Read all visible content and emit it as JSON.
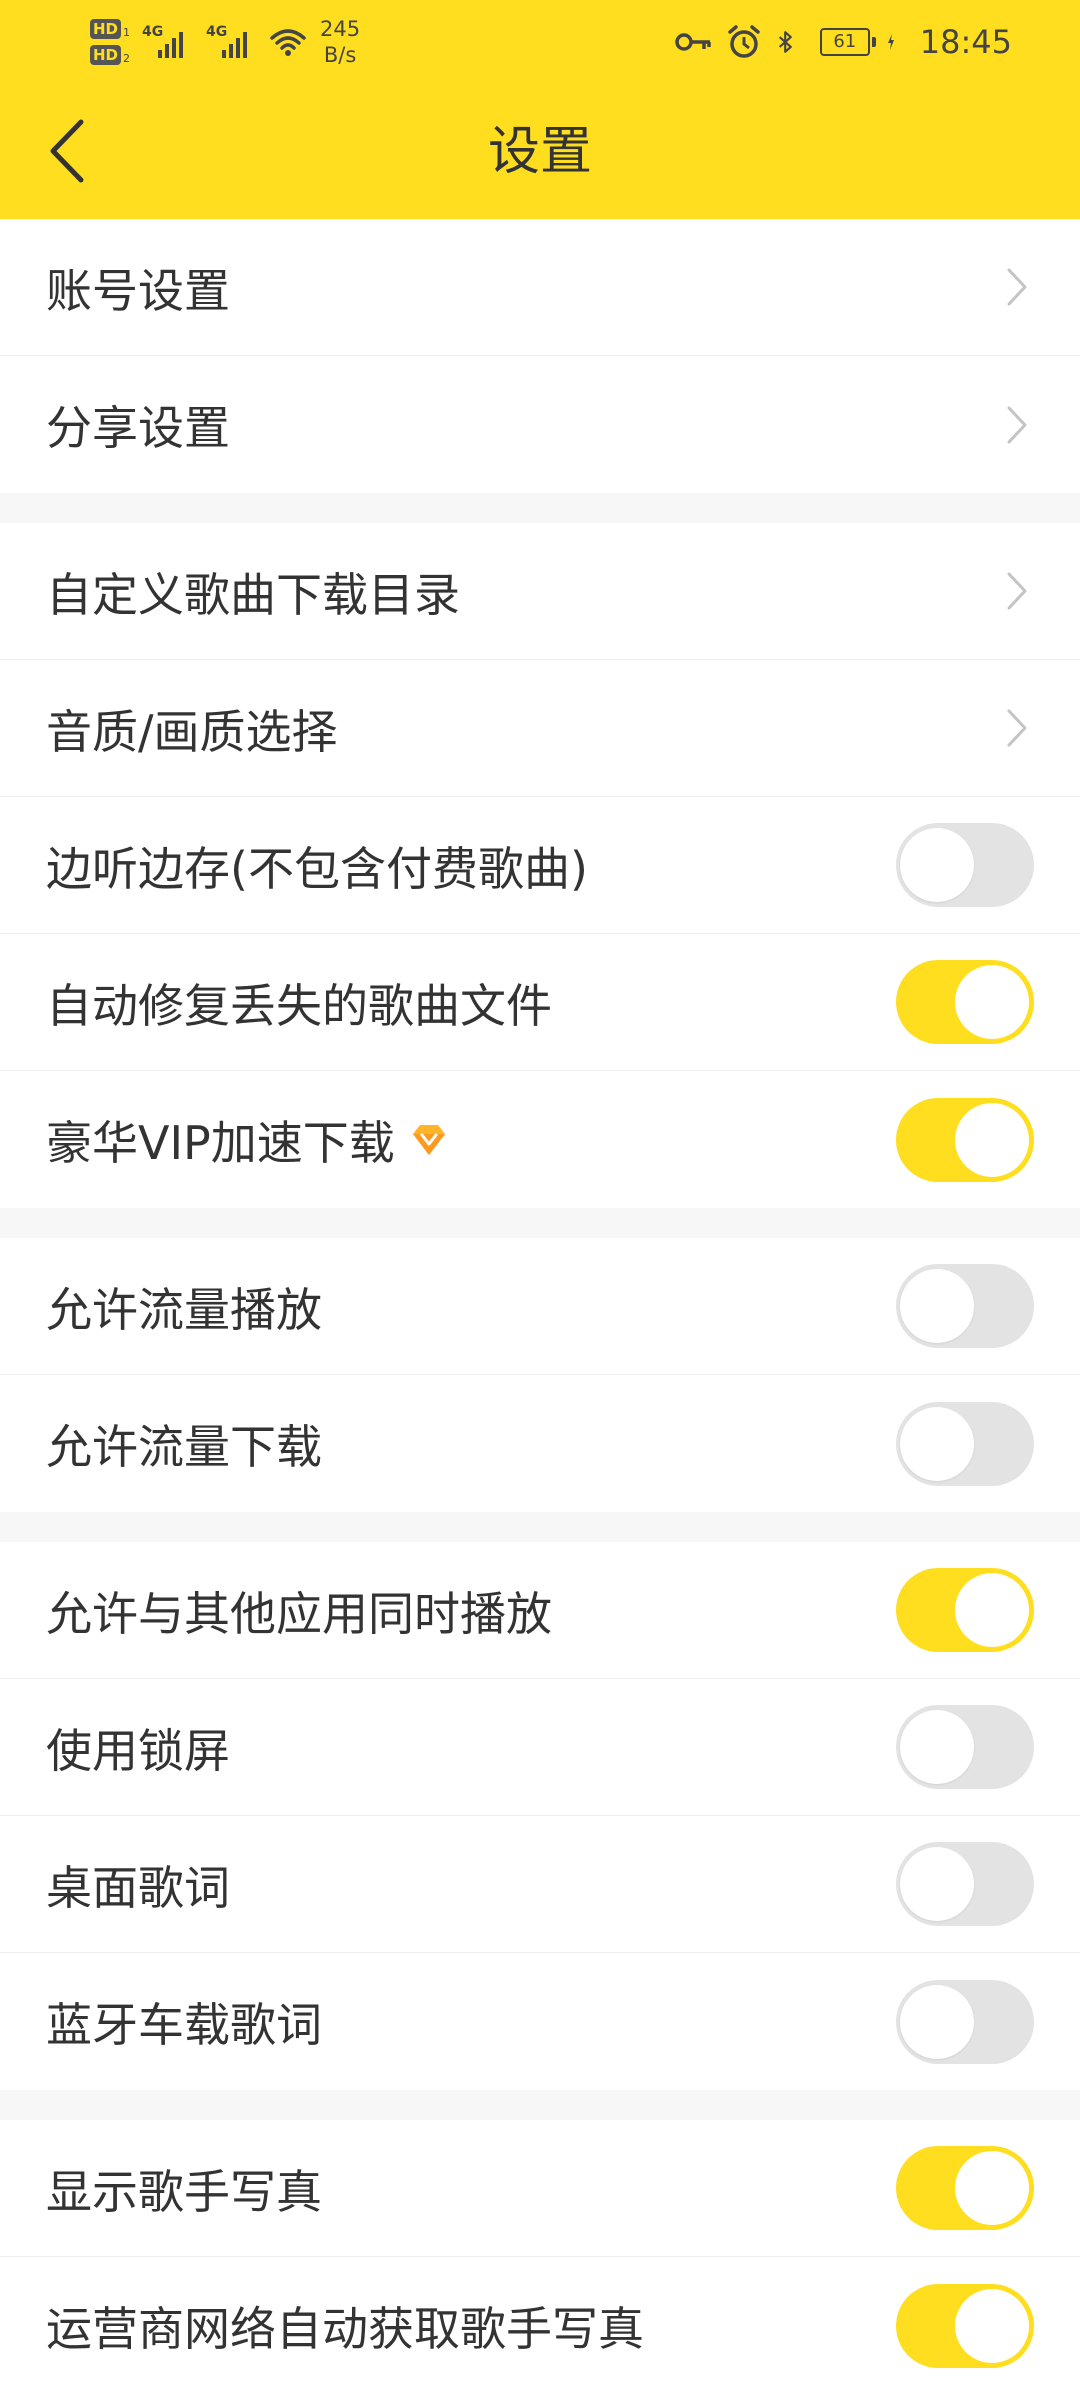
{
  "status_bar": {
    "hd1": "HD",
    "hd1_num": "1",
    "hd2": "HD",
    "hd2_num": "2",
    "net1": "4G",
    "net2": "4G",
    "speed_value": "245",
    "speed_unit": "B/s",
    "battery": "61",
    "time": "18:45",
    "icons": [
      "key-icon",
      "alarm-icon",
      "bluetooth-icon",
      "charging-icon"
    ]
  },
  "header": {
    "title": "设置",
    "back_icon": "chevron-left-icon",
    "background": "#ffde20"
  },
  "colors": {
    "accent": "#ffde20",
    "toggle_off": "#e3e3e3",
    "text": "#333333",
    "divider": "#eeeeee",
    "section_gap": "#f7f7f7"
  },
  "sections": [
    {
      "items": [
        {
          "label": "账号设置",
          "control": "chevron"
        },
        {
          "label": "分享设置",
          "control": "chevron"
        }
      ]
    },
    {
      "items": [
        {
          "label": "自定义歌曲下载目录",
          "control": "chevron"
        },
        {
          "label": "音质/画质选择",
          "control": "chevron"
        },
        {
          "label": "边听边存(不包含付费歌曲)",
          "control": "toggle",
          "on": false
        },
        {
          "label": "自动修复丢失的歌曲文件",
          "control": "toggle",
          "on": true
        },
        {
          "label": "豪华VIP加速下载",
          "control": "toggle",
          "on": true,
          "badge": "vip-diamond-icon"
        }
      ]
    },
    {
      "items": [
        {
          "label": "允许流量播放",
          "control": "toggle",
          "on": false
        },
        {
          "label": "允许流量下载",
          "control": "toggle",
          "on": false
        }
      ]
    },
    {
      "items": [
        {
          "label": "允许与其他应用同时播放",
          "control": "toggle",
          "on": true
        },
        {
          "label": "使用锁屏",
          "control": "toggle",
          "on": false
        },
        {
          "label": "桌面歌词",
          "control": "toggle",
          "on": false
        },
        {
          "label": "蓝牙车载歌词",
          "control": "toggle",
          "on": false
        }
      ]
    },
    {
      "items": [
        {
          "label": "显示歌手写真",
          "control": "toggle",
          "on": true
        },
        {
          "label": "运营商网络自动获取歌手写真",
          "control": "toggle",
          "on": true
        }
      ]
    }
  ]
}
